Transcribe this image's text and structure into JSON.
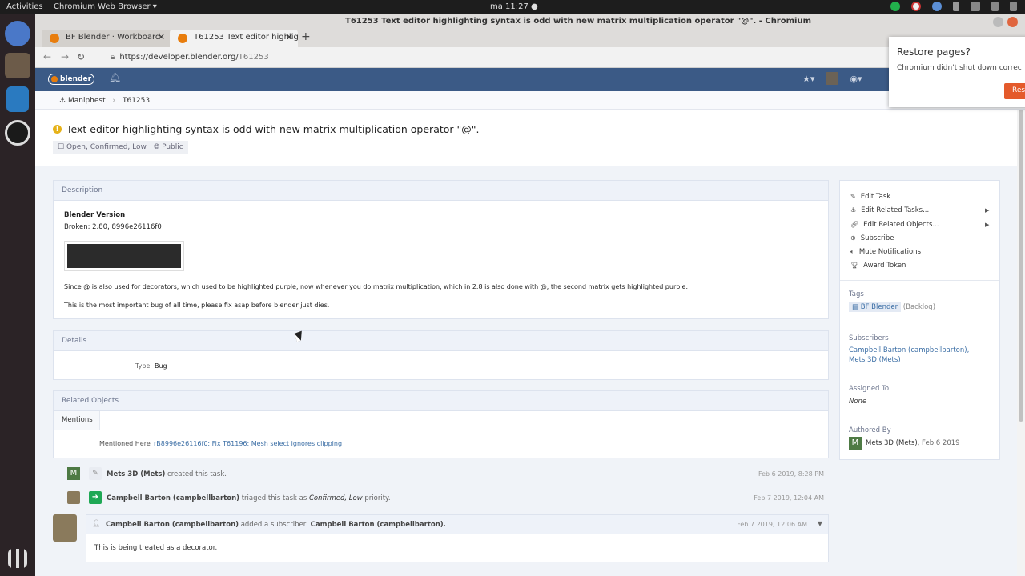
{
  "os": {
    "activities": "Activities",
    "app_menu": "Chromium Web Browser ▾",
    "clock": "ma 11:27 ●"
  },
  "browser": {
    "window_title": "T61253 Text editor highlighting syntax is odd with new matrix multiplication operator \"@\". - Chromium",
    "tabs": [
      {
        "label": "BF Blender · Workboard"
      },
      {
        "label": "T61253 Text editor highligh"
      }
    ],
    "url_prefix": "https://developer.blender.org/",
    "url_path": "T61253",
    "restore": {
      "title": "Restore pages?",
      "message": "Chromium didn't shut down correc",
      "button": "Res"
    }
  },
  "header": {
    "logo": "blender"
  },
  "breadcrumbs": [
    "Maniphest",
    "T61253"
  ],
  "task": {
    "title": "Text editor highlighting syntax is odd with new matrix multiplication operator \"@\".",
    "status": "Open, Confirmed, Low",
    "visibility": "Public"
  },
  "description": {
    "header": "Description",
    "version_label": "Blender Version",
    "broken": "Broken: 2.80, 8996e26116f0",
    "para1": "Since @ is also used for decorators, which used to be highlighted purple, now whenever you do matrix multiplication, which in 2.8 is also done with @, the second matrix gets highlighted purple.",
    "para2": "This is the most important bug of all time, please fix asap before blender just dies."
  },
  "details": {
    "header": "Details",
    "type_label": "Type",
    "type_value": "Bug"
  },
  "related": {
    "header": "Related Objects",
    "tab": "Mentions",
    "mentioned_label": "Mentioned Here",
    "mentioned_link": "rB8996e26116f0: Fix T61196: Mesh select ignores clipping"
  },
  "actions": [
    {
      "label": "Edit Task",
      "icon": "pencil-icon"
    },
    {
      "label": "Edit Related Tasks...",
      "icon": "anchor-icon"
    },
    {
      "label": "Edit Related Objects...",
      "icon": "link-icon"
    },
    {
      "label": "Subscribe",
      "icon": "plus-circle-icon"
    },
    {
      "label": "Mute Notifications",
      "icon": "volume-icon"
    },
    {
      "label": "Award Token",
      "icon": "trophy-icon"
    }
  ],
  "sidebar": {
    "tags_label": "Tags",
    "tag_name": "BF Blender",
    "tag_column": "(Backlog)",
    "subscribers_label": "Subscribers",
    "subscriber1": "Campbell Barton (campbellbarton),",
    "subscriber2": "Mets 3D (Mets)",
    "assigned_label": "Assigned To",
    "assigned_value": "None",
    "authored_label": "Authored By",
    "author_name": "Mets 3D (Mets)",
    "author_date": ", Feb 6 2019"
  },
  "timeline": [
    {
      "user": "Mets 3D (Mets)",
      "text": " created this task.",
      "date": "Feb 6 2019, 8:28 PM"
    },
    {
      "user": "Campbell Barton (campbellbarton)",
      "text_a": " triaged this task as ",
      "emph": "Confirmed, Low",
      "text_b": " priority.",
      "date": "Feb 7 2019, 12:04 AM"
    }
  ],
  "comment": {
    "user": "Campbell Barton (campbellbarton)",
    "text": " added a subscriber: ",
    "target": "Campbell Barton (campbellbarton).",
    "date": "Feb 7 2019, 12:06 AM",
    "body": "This is being treated as a decorator."
  },
  "colors": {
    "phab_header": "#3b5a86",
    "link": "#3b6ea5",
    "warning": "#e6b219",
    "triage_green": "#1fa855",
    "restore_button": "#e45a2b"
  }
}
